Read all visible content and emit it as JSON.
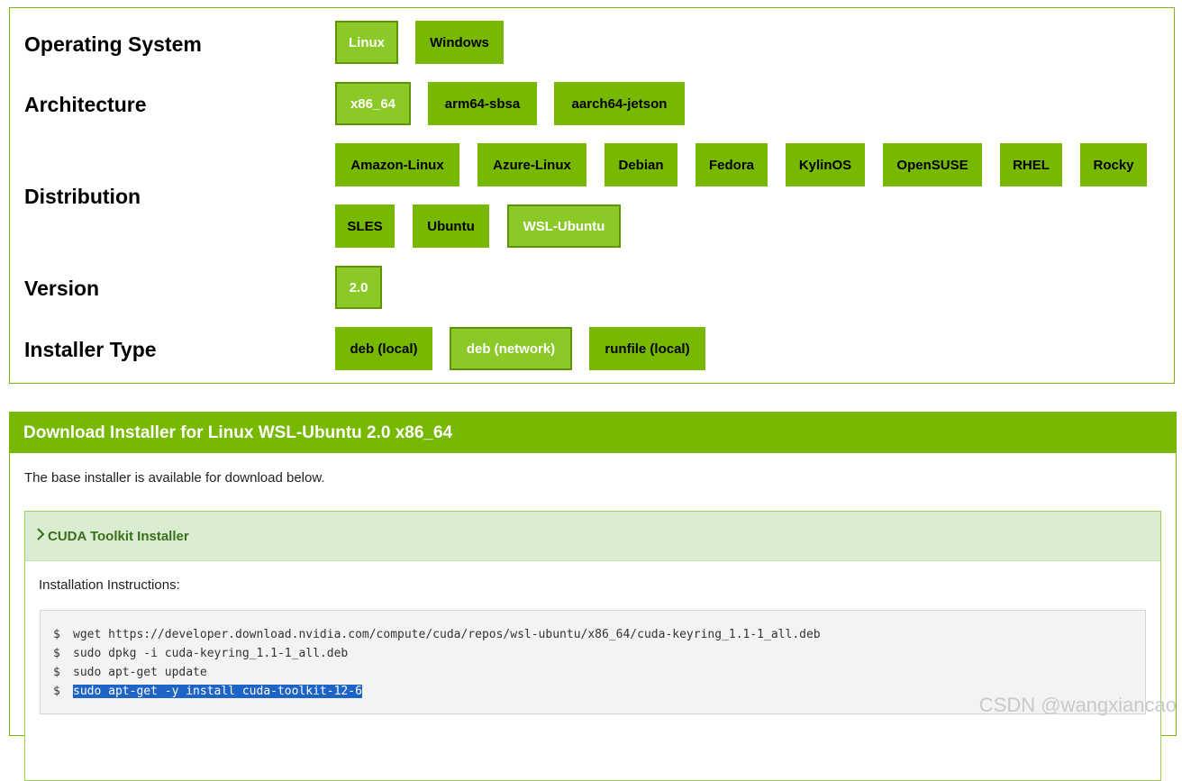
{
  "selector": {
    "rows": [
      {
        "label": "Operating System",
        "options": [
          "Linux",
          "Windows"
        ],
        "selected": "Linux"
      },
      {
        "label": "Architecture",
        "options": [
          "x86_64",
          "arm64-sbsa",
          "aarch64-jetson"
        ],
        "selected": "x86_64"
      },
      {
        "label": "Distribution",
        "options": [
          "Amazon-Linux",
          "Azure-Linux",
          "Debian",
          "Fedora",
          "KylinOS",
          "OpenSUSE",
          "RHEL",
          "Rocky",
          "SLES",
          "Ubuntu",
          "WSL-Ubuntu"
        ],
        "selected": "WSL-Ubuntu"
      },
      {
        "label": "Version",
        "options": [
          "2.0"
        ],
        "selected": "2.0"
      },
      {
        "label": "Installer Type",
        "options": [
          "deb (local)",
          "deb (network)",
          "runfile (local)"
        ],
        "selected": "deb (network)"
      }
    ]
  },
  "download": {
    "title": "Download Installer for Linux WSL-Ubuntu 2.0 x86_64",
    "description": "The base installer is available for download below.",
    "toolkit": {
      "title": "CUDA Toolkit Installer",
      "chevron_icon": "chevron-right-icon",
      "instructions_label": "Installation Instructions:",
      "prompt": "$",
      "commands": [
        "wget https://developer.download.nvidia.com/compute/cuda/repos/wsl-ubuntu/x86_64/cuda-keyring_1.1-1_all.deb",
        "sudo dpkg -i cuda-keyring_1.1-1_all.deb",
        "sudo apt-get update",
        "sudo apt-get -y install cuda-toolkit-12-6"
      ],
      "highlighted_command_index": 3
    }
  },
  "watermark": "CSDN @wangxiancao",
  "colors": {
    "accent": "#76b900",
    "selected": "#8ac926",
    "toolkit_header_bg": "#daecd2",
    "selection_highlight": "#1e63c6"
  }
}
